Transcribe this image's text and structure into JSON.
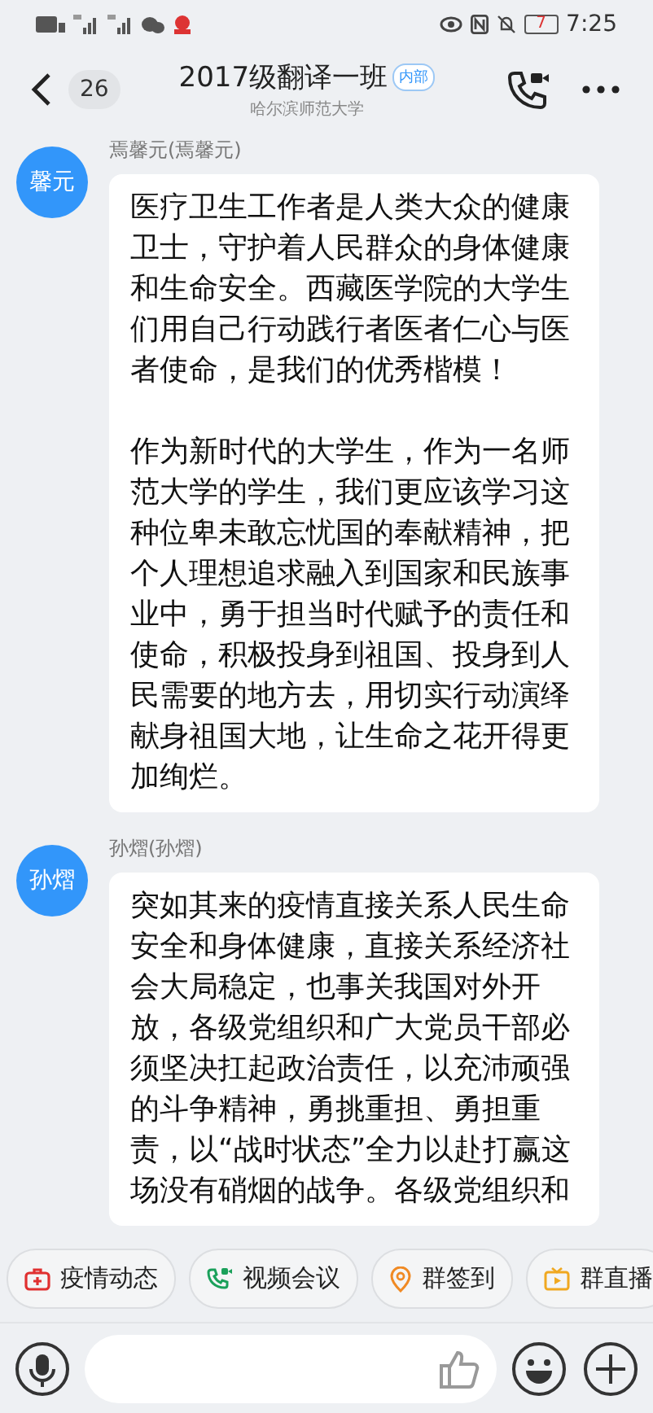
{
  "status_bar": {
    "battery": "7",
    "time": "7:25"
  },
  "header": {
    "unread_count": "26",
    "title": "2017级翻译一班",
    "tag": "内部",
    "subtitle": "哈尔滨师范大学"
  },
  "messages": [
    {
      "avatar": "馨元",
      "sender": "焉馨元(焉馨元)",
      "paragraphs": [
        "医疗卫生工作者是人类大众的健康卫士，守护着人民群众的身体健康和生命安全。西藏医学院的大学生们用自己行动践行者医者仁心与医者使命，是我们的优秀楷模！",
        "作为新时代的大学生，作为一名师范大学的学生，我们更应该学习这种位卑未敢忘忧国的奉献精神，把个人理想追求融入到国家和民族事业中，勇于担当时代赋予的责任和使命，积极投身到祖国、投身到人民需要的地方去，用切实行动演绎献身祖国大地，让生命之花开得更加绚烂。"
      ]
    },
    {
      "avatar": "孙熠",
      "sender": "孙熠(孙熠)",
      "paragraphs": [
        "突如其来的疫情直接关系人民生命安全和身体健康，直接关系经济社会大局稳定，也事关我国对外开放，各级党组织和广大党员干部必须坚决扛起政治责任，以充沛顽强的斗争精神，勇挑重担、勇担重责，以“战时状态”全力以赴打赢这场没有硝烟的战争。各级党组织和"
      ]
    }
  ],
  "quick_actions": [
    {
      "kind": "medkit",
      "label": "疫情动态"
    },
    {
      "kind": "video_call",
      "label": "视频会议"
    },
    {
      "kind": "checkin",
      "label": "群签到"
    },
    {
      "kind": "live",
      "label": "群直播"
    }
  ]
}
